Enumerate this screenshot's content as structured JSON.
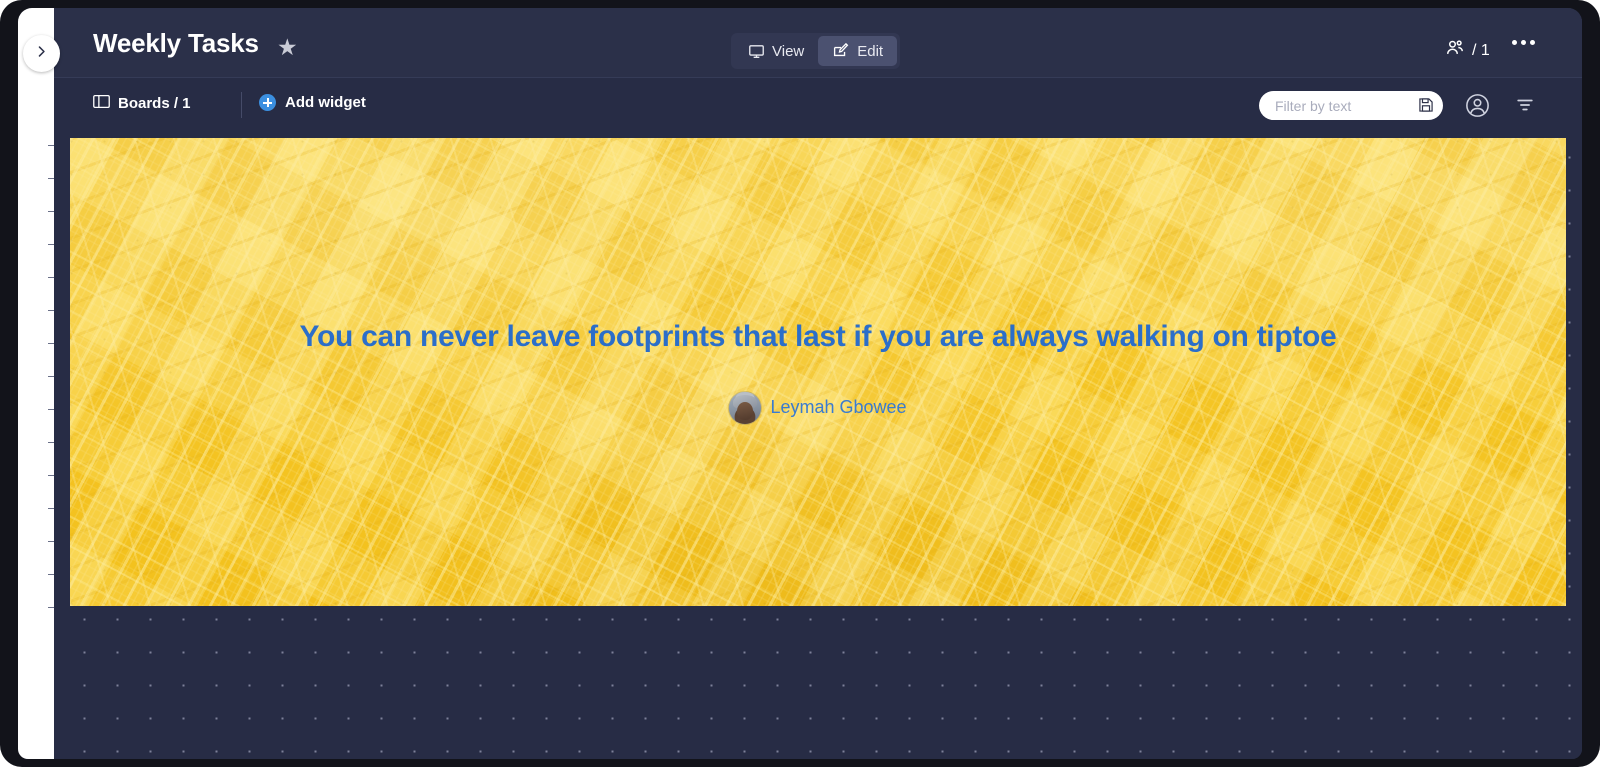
{
  "header": {
    "title": "Weekly Tasks",
    "favorite_icon": "star-icon",
    "sidebar_toggle_icon": "chevron-right-icon",
    "view_mode": {
      "view_label": "View",
      "view_icon": "monitor-icon",
      "edit_label": "Edit",
      "edit_icon": "edit-pencil-icon",
      "active": "Edit"
    },
    "members": {
      "icon": "users-icon",
      "label": "/ 1"
    },
    "overflow_icon": "ellipsis-horizontal-icon"
  },
  "toolbar": {
    "boards_label": "Boards / 1",
    "boards_icon": "board-layout-icon",
    "add_widget_label": "Add widget",
    "add_widget_icon": "plus-circle-icon",
    "filter": {
      "value": "",
      "placeholder": "Filter by text",
      "save_icon": "save-floppy-icon"
    },
    "account_icon": "user-circle-icon",
    "filter_icon": "filter-lines-icon"
  },
  "widget": {
    "type": "quote-widget",
    "quote": "You can never leave footprints that last if you are always walking on tiptoe",
    "author": "Leymah Gbowee",
    "author_avatar": "author-portrait-avatar",
    "background": "aerial-cityscape-photo"
  },
  "colors": {
    "header_bg": "#2b3049",
    "canvas_bg": "#272c45",
    "accent_blue": "#3b8fe0",
    "quote_blue": "#2b6ec9",
    "widget_yellow": "#f7cf36",
    "rail_white": "#ffffff"
  }
}
